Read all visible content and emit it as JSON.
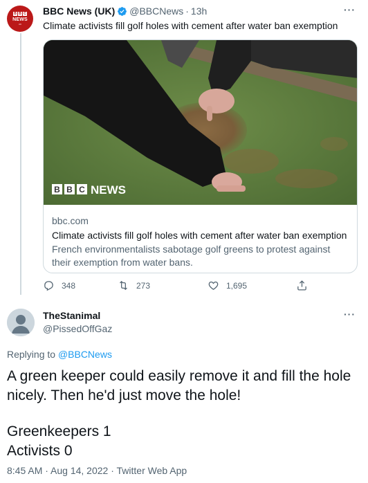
{
  "tweet1": {
    "author_name": "BBC News (UK)",
    "handle": "@BBCNews",
    "separator": "·",
    "time": "13h",
    "more": "···",
    "text": "Climate activists fill golf holes with cement after water ban exemption",
    "avatar": {
      "blocks": [
        "B",
        "B",
        "C"
      ],
      "word": "NEWS",
      "sub": "UK",
      "color": "#bb1919"
    },
    "card": {
      "image_watermark_blocks": [
        "B",
        "B",
        "C"
      ],
      "image_watermark_word": "NEWS",
      "domain": "bbc.com",
      "title": "Climate activists fill golf holes with cement after water ban exemption",
      "description": "French environmentalists sabotage golf greens to protest against their exemption from water bans."
    },
    "actions": {
      "reply": {
        "icon": "reply-icon",
        "count": "348"
      },
      "retweet": {
        "icon": "retweet-icon",
        "count": "273"
      },
      "like": {
        "icon": "like-icon",
        "count": "1,695"
      },
      "share": {
        "icon": "share-icon"
      }
    }
  },
  "tweet2": {
    "author_name": "TheStanimal",
    "handle": "@PissedOffGaz",
    "more": "···",
    "replying_prefix": "Replying to",
    "replying_to": "@BBCNews",
    "text_line1": "A green keeper could easily remove it and fill the hole nicely. Then he'd just move the hole!",
    "text_line2": "Greenkeepers 1",
    "text_line3": "Activists 0",
    "footer": "8:45 AM · Aug 14, 2022 · Twitter Web App"
  },
  "colors": {
    "link": "#1d9bf0",
    "secondary_text": "#536471",
    "border": "#cfd9de",
    "bbc_red": "#bb1919"
  }
}
